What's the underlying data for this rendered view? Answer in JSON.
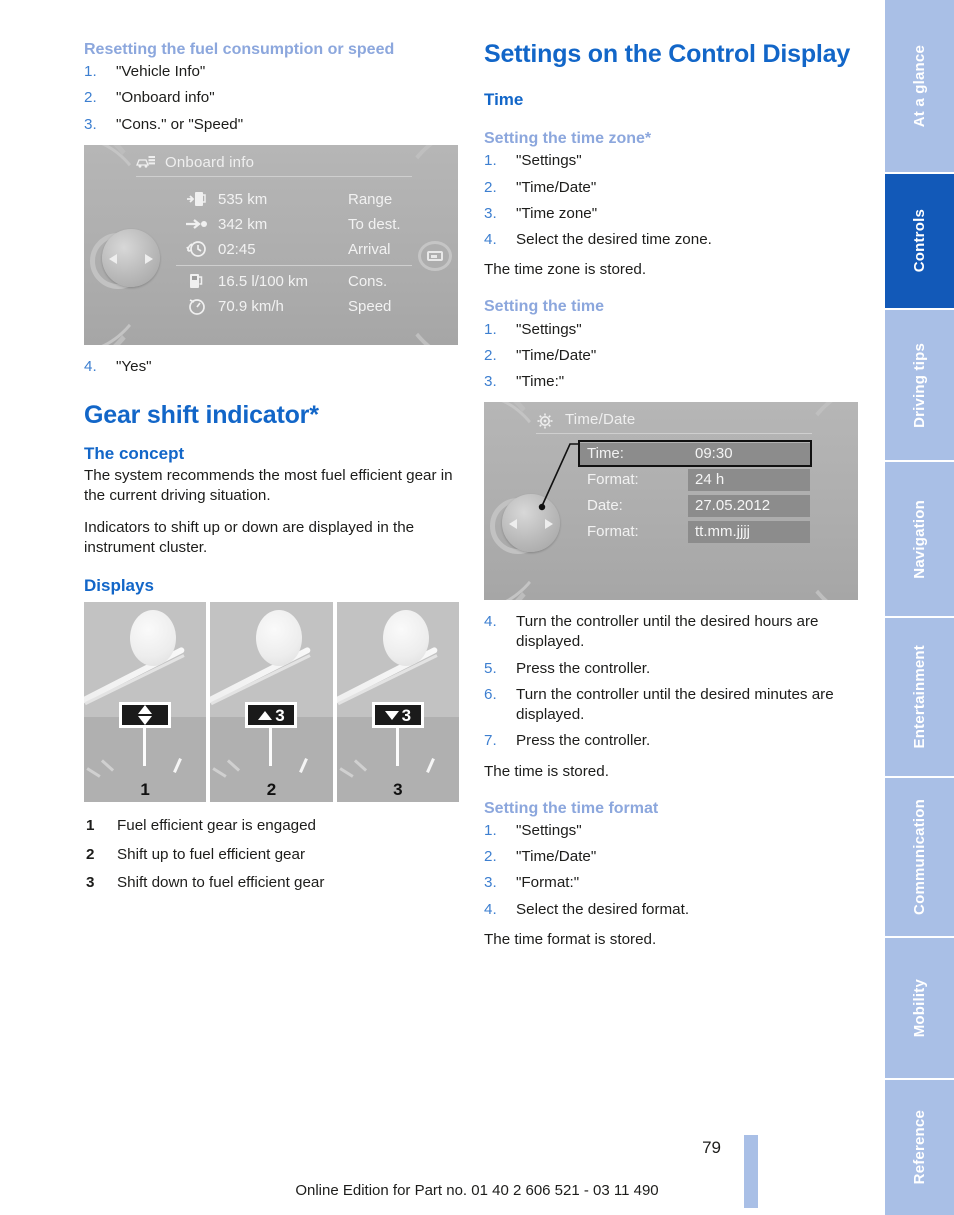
{
  "page": {
    "number": "79",
    "footer": "Online Edition for Part no. 01 40 2 606 521 - 03 11 490"
  },
  "tabs": [
    {
      "label": "At a glance",
      "active": false
    },
    {
      "label": "Controls",
      "active": true
    },
    {
      "label": "Driving tips",
      "active": false
    },
    {
      "label": "Navigation",
      "active": false
    },
    {
      "label": "Entertainment",
      "active": false
    },
    {
      "label": "Communication",
      "active": false
    },
    {
      "label": "Mobility",
      "active": false
    },
    {
      "label": "Reference",
      "active": false
    }
  ],
  "left": {
    "reset": {
      "heading": "Resetting the fuel consumption or speed",
      "steps": [
        {
          "num": "1.",
          "text": "\"Vehicle Info\""
        },
        {
          "num": "2.",
          "text": "\"Onboard info\""
        },
        {
          "num": "3.",
          "text": "\"Cons.\" or \"Speed\""
        }
      ],
      "after_step": {
        "num": "4.",
        "text": "\"Yes\""
      }
    },
    "onboard_display": {
      "title": "Onboard info",
      "title_icon": "onboard-info-icon",
      "rows": [
        {
          "icon": "fuel-range-icon",
          "value": "535 km",
          "label": "Range"
        },
        {
          "icon": "destination-icon",
          "value": "342 km",
          "label": "To dest."
        },
        {
          "icon": "arrival-time-icon",
          "value": "02:45",
          "label": "Arrival"
        },
        {
          "icon": "fuel-pump-icon",
          "value": "16.5 l/100 km",
          "label": "Cons."
        },
        {
          "icon": "speedometer-icon",
          "value": "70.9 km/h",
          "label": "Speed"
        }
      ]
    },
    "gear": {
      "title": "Gear shift indicator*",
      "concept_heading": "The concept",
      "concept_p1": "The system recommends the most fuel efficient gear in the current driving situation.",
      "concept_p2": "Indicators to shift up or down are displayed in the instrument cluster.",
      "displays_heading": "Displays",
      "figures": [
        {
          "caption": "1",
          "badge_type": "both",
          "gear": ""
        },
        {
          "caption": "2",
          "badge_type": "up",
          "gear": "3"
        },
        {
          "caption": "3",
          "badge_type": "down",
          "gear": "3"
        }
      ],
      "legend": [
        {
          "key": "1",
          "text": "Fuel efficient gear is engaged"
        },
        {
          "key": "2",
          "text": "Shift up to fuel efficient gear"
        },
        {
          "key": "3",
          "text": "Shift down to fuel efficient gear"
        }
      ]
    }
  },
  "right": {
    "title": "Settings on the Control Display",
    "time_heading": "Time",
    "time_zone": {
      "heading": "Setting the time zone*",
      "steps": [
        {
          "num": "1.",
          "text": "\"Settings\""
        },
        {
          "num": "2.",
          "text": "\"Time/Date\""
        },
        {
          "num": "3.",
          "text": "\"Time zone\""
        },
        {
          "num": "4.",
          "text": "Select the desired time zone."
        }
      ],
      "result": "The time zone is stored."
    },
    "setting_time": {
      "heading": "Setting the time",
      "steps_before": [
        {
          "num": "1.",
          "text": "\"Settings\""
        },
        {
          "num": "2.",
          "text": "\"Time/Date\""
        },
        {
          "num": "3.",
          "text": "\"Time:\""
        }
      ],
      "steps_after": [
        {
          "num": "4.",
          "text": "Turn the controller until the desired hours are displayed."
        },
        {
          "num": "5.",
          "text": "Press the controller."
        },
        {
          "num": "6.",
          "text": "Turn the controller until the desired minutes are displayed."
        },
        {
          "num": "7.",
          "text": "Press the controller."
        }
      ],
      "result": "The time is stored."
    },
    "timedate_display": {
      "title": "Time/Date",
      "title_icon": "settings-gear-icon",
      "rows": [
        {
          "label": "Time:",
          "value": "09:30",
          "selected": true
        },
        {
          "label": "Format:",
          "value": "24 h",
          "selected": false
        },
        {
          "label": "Date:",
          "value": "27.05.2012",
          "selected": false
        },
        {
          "label": "Format:",
          "value": "tt.mm.jjjj",
          "selected": false
        }
      ]
    },
    "time_format": {
      "heading": "Setting the time format",
      "steps": [
        {
          "num": "1.",
          "text": "\"Settings\""
        },
        {
          "num": "2.",
          "text": "\"Time/Date\""
        },
        {
          "num": "3.",
          "text": "\"Format:\""
        },
        {
          "num": "4.",
          "text": "Select the desired format."
        }
      ],
      "result": "The time format is stored."
    }
  },
  "colors": {
    "heading_blue": "#1266c8",
    "sub_heading_blue": "#8ca7dd",
    "step_number_blue": "#3d7fd0",
    "tab_inactive": "#a9bfe6",
    "tab_active": "#1259b8"
  }
}
